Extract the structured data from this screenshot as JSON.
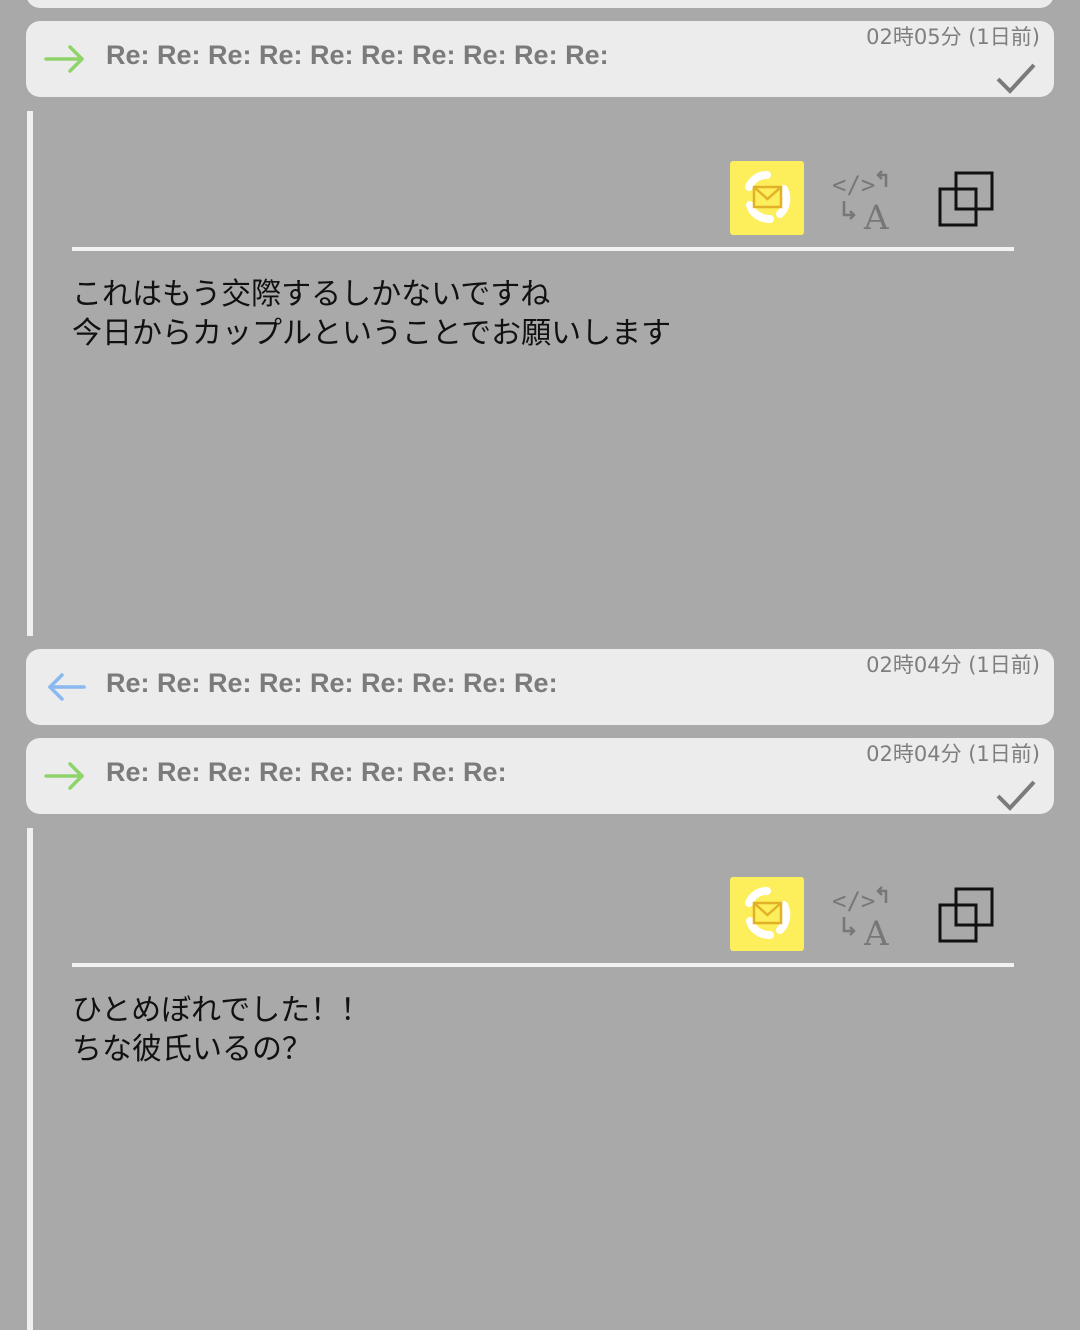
{
  "colors": {
    "background": "#a9a9a9",
    "card": "#ececec",
    "sent_arrow": "#8fd46a",
    "received_arrow": "#8ab8f0",
    "mail_button": "#fdee5c",
    "mail_icon": "#e2b128"
  },
  "messages": [
    {
      "direction": "sent",
      "arrow_icon": "arrow-right-icon",
      "subject": "Re: Re: Re: Re: Re: Re: Re: Re: Re: Re:",
      "timestamp": "02時05分 (1日前)",
      "read": true,
      "body_lines": [
        "これはもう交際するしかないですね",
        "今日からカップルということでお願いします"
      ]
    },
    {
      "direction": "received",
      "arrow_icon": "arrow-left-icon",
      "subject": "Re: Re: Re: Re: Re: Re: Re: Re: Re:",
      "timestamp": "02時04分 (1日前)",
      "read": false
    },
    {
      "direction": "sent",
      "arrow_icon": "arrow-right-icon",
      "subject": "Re: Re: Re: Re: Re: Re: Re: Re:",
      "timestamp": "02時04分 (1日前)",
      "read": true,
      "body_lines": [
        "ひとめぼれでした！！",
        "ちな彼氏いるの？"
      ]
    }
  ],
  "toolbar_icons": [
    "mail-recycle-icon",
    "source-translate-icon",
    "copy-icon"
  ]
}
